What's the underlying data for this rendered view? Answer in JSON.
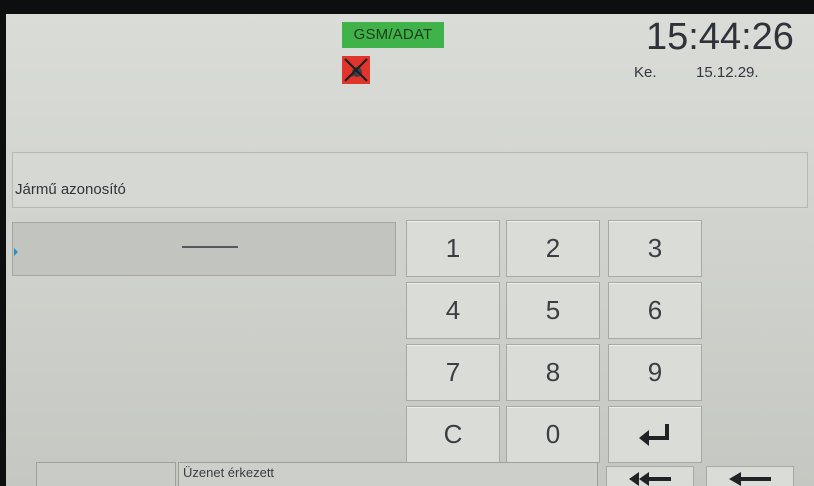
{
  "status": {
    "network_label": "GSM/ADAT",
    "connection_icon": "no-connection-icon",
    "time": "15:44:26",
    "day": "Ke.",
    "date": "15.12.29."
  },
  "field": {
    "label": "Jármű azonosító",
    "value": "",
    "empty_value_glyph": "dash"
  },
  "keypad": {
    "keys": [
      "1",
      "2",
      "3",
      "4",
      "5",
      "6",
      "7",
      "8",
      "9",
      "C",
      "0"
    ],
    "enter_icon": "enter-icon"
  },
  "footer": {
    "message": "Üzenet érkezett",
    "nav_back_fast_icon": "double-arrow-left-icon",
    "nav_back_icon": "arrow-left-icon"
  },
  "colors": {
    "gsm_badge": "#3fb34a",
    "screen_bg": "#d9dcd7",
    "no_connection_red": "#e0352d"
  }
}
